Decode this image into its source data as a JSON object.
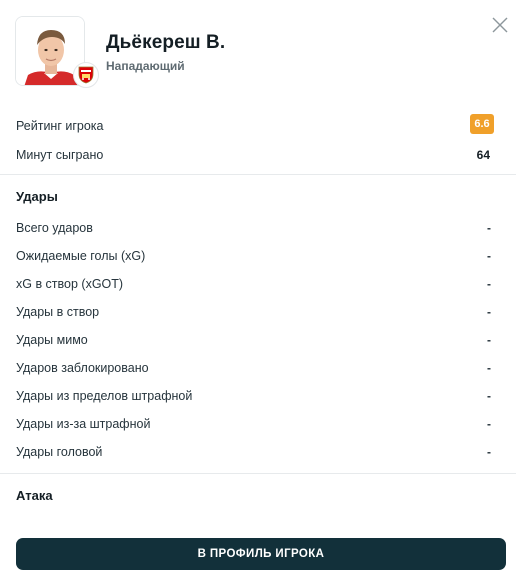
{
  "player": {
    "name": "Дьёкереш В.",
    "position": "Нападающий",
    "photo_icon": "player-photo",
    "club_icon": "arsenal-crest-icon"
  },
  "summary": {
    "rating_label": "Рейтинг игрока",
    "rating_value": "6.6",
    "rating_color": "#f0a02a",
    "minutes_label": "Минут сыграно",
    "minutes_value": "64"
  },
  "shots": {
    "title": "Удары",
    "rows": [
      {
        "label": "Всего ударов",
        "value": "-"
      },
      {
        "label": "Ожидаемые голы (xG)",
        "value": "-"
      },
      {
        "label": "xG в створ (xGOT)",
        "value": "-"
      },
      {
        "label": "Удары в створ",
        "value": "-"
      },
      {
        "label": "Удары мимо",
        "value": "-"
      },
      {
        "label": "Ударов заблокировано",
        "value": "-"
      },
      {
        "label": "Удары из пределов штрафной",
        "value": "-"
      },
      {
        "label": "Удары из-за штрафной",
        "value": "-"
      },
      {
        "label": "Удары головой",
        "value": "-"
      }
    ]
  },
  "attack": {
    "title": "Атака"
  },
  "cta": {
    "label": "В ПРОФИЛЬ ИГРОКА",
    "color": "#12303a"
  },
  "close": {
    "icon": "close-icon"
  }
}
